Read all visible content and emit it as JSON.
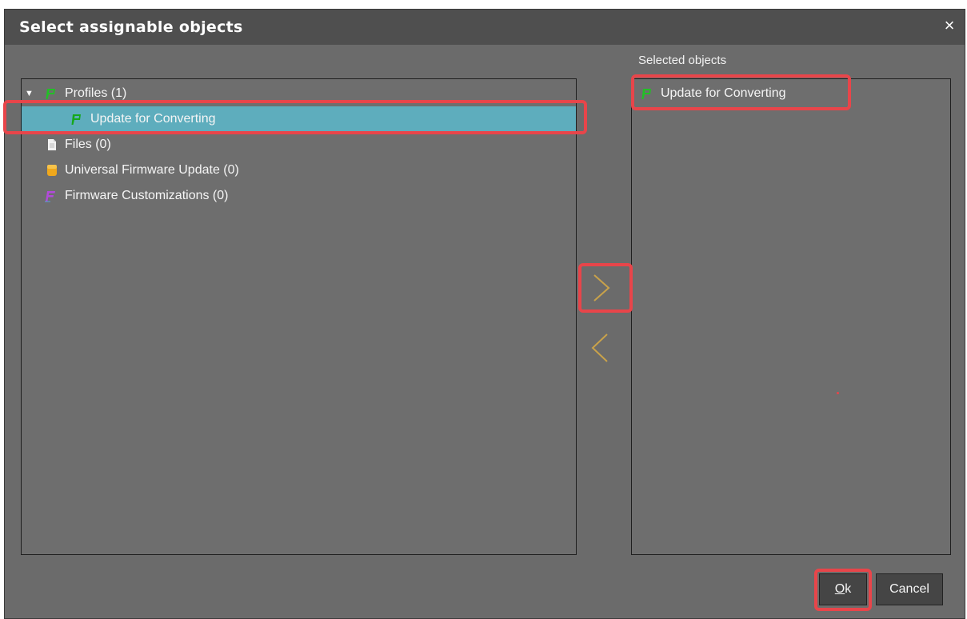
{
  "dialog": {
    "title": "Select assignable objects",
    "close_glyph": "×"
  },
  "available": {
    "items": [
      {
        "label": "Profiles (1)",
        "icon": "profile-icon",
        "expanded": true
      },
      {
        "label": "Update for Converting",
        "icon": "profile-icon",
        "selected": true
      },
      {
        "label": "Files (0)",
        "icon": "file-icon"
      },
      {
        "label": "Universal Firmware Update (0)",
        "icon": "firmware-update-icon"
      },
      {
        "label": "Firmware Customizations (0)",
        "icon": "firmware-customization-icon"
      }
    ]
  },
  "selected": {
    "header": "Selected objects",
    "items": [
      {
        "label": "Update for Converting",
        "icon": "profile-icon"
      }
    ]
  },
  "buttons": {
    "ok_first": "O",
    "ok_rest": "k",
    "cancel": "Cancel"
  },
  "colors": {
    "accent_selection": "#5eadbd",
    "highlight_box": "#e8454a",
    "arrow": "#c9a24a",
    "profile_icon": "#22c026"
  }
}
